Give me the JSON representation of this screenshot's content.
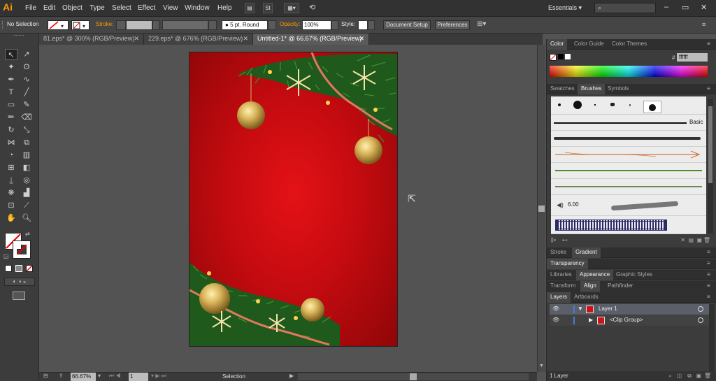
{
  "app": {
    "logo": "Ai",
    "menu": [
      "File",
      "Edit",
      "Object",
      "Type",
      "Select",
      "Effect",
      "View",
      "Window",
      "Help"
    ],
    "workspace": "Essentials",
    "window_controls": [
      "–",
      "▭",
      "✕"
    ]
  },
  "control_bar": {
    "selection_label": "No Selection",
    "stroke_label": "Stroke:",
    "brush_value": "5 pt. Round",
    "opacity_label": "Opacity:",
    "opacity_value": "100%",
    "style_label": "Style:",
    "document_setup": "Document Setup",
    "preferences": "Preferences"
  },
  "doc_tabs": [
    {
      "label": "81.eps* @ 300% (RGB/Preview)"
    },
    {
      "label": "229.eps* @ 676% (RGB/Preview)"
    },
    {
      "label": "Untitled-1* @ 66.67% (RGB/Preview)"
    }
  ],
  "tab_close": "✕",
  "status_bar": {
    "zoom": "66.67%",
    "page": "1",
    "tool": "Selection"
  },
  "panels": {
    "color": {
      "tabs": [
        "Color",
        "Color Guide",
        "Color Themes"
      ],
      "hex_label": "#",
      "hex_value": "ffffff"
    },
    "brushes": {
      "tabs": [
        "Swatches",
        "Brushes",
        "Symbols"
      ],
      "basic_label": "Basic",
      "size_value": "6.00"
    },
    "stroke_group": {
      "tabs": [
        "Stroke",
        "Gradient"
      ]
    },
    "transparency": {
      "tabs": [
        "Transparency"
      ]
    },
    "appearance_group": {
      "tabs": [
        "Libraries",
        "Appearance",
        "Graphic Styles"
      ]
    },
    "align_group": {
      "tabs": [
        "Transform",
        "Align",
        "Pathfinder"
      ]
    },
    "layers": {
      "tabs": [
        "Layers",
        "Artboards"
      ],
      "rows": [
        {
          "name": "Layer 1"
        },
        {
          "name": "<Clip Group>"
        }
      ],
      "footer": "1 Layer"
    }
  },
  "colors": {
    "accent_orange": "#ff9a00",
    "artboard_red": "#d40c10",
    "panel_bg": "#3c3c3c",
    "layer_blue": "#4a7bd0"
  }
}
